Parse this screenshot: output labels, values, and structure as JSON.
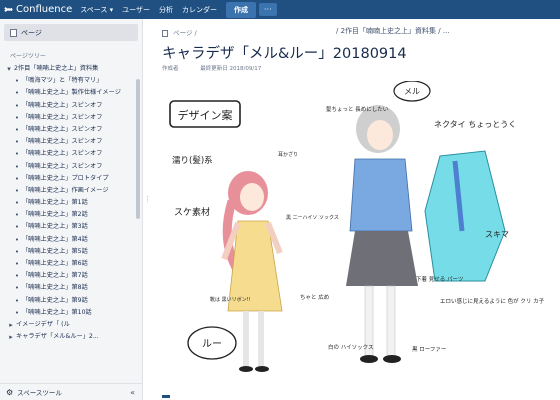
{
  "topbar": {
    "logo": "Confluence",
    "nav": [
      "スペース ▾",
      "ユーザー",
      "分析",
      "カレンダー"
    ],
    "create": "作成",
    "more": "···"
  },
  "sidebar": {
    "pages_label": "ページ",
    "tree_heading": "ページツリー",
    "items": [
      {
        "bullet": "▾",
        "label": "2作目「喃喃上史之上」資料集",
        "level": 0
      },
      {
        "bullet": "•",
        "label": "「鳴海マツ」と「特有マリ」",
        "level": 1
      },
      {
        "bullet": "•",
        "label": "「喃喃上史之上」製作仕様イメージ",
        "level": 1
      },
      {
        "bullet": "•",
        "label": "「喃喃上史之上」スピンオフ",
        "level": 1
      },
      {
        "bullet": "•",
        "label": "「喃喃上史之上」スピンオフ",
        "level": 1
      },
      {
        "bullet": "•",
        "label": "「喃喃上史之上」スピンオフ",
        "level": 1
      },
      {
        "bullet": "•",
        "label": "「喃喃上史之上」スピンオフ",
        "level": 1
      },
      {
        "bullet": "•",
        "label": "「喃喃上史之上」スピンオフ",
        "level": 1
      },
      {
        "bullet": "•",
        "label": "「喃喃上史之上」スピンオフ",
        "level": 1
      },
      {
        "bullet": "•",
        "label": "「喃喃上史之上」プロトタイプ",
        "level": 1
      },
      {
        "bullet": "•",
        "label": "「喃喃上史之上」作画イメージ",
        "level": 1
      },
      {
        "bullet": "•",
        "label": "「喃喃上史之上」第1話",
        "level": 1
      },
      {
        "bullet": "•",
        "label": "「喃喃上史之上」第2話",
        "level": 1
      },
      {
        "bullet": "•",
        "label": "「喃喃上史之上」第3話",
        "level": 1
      },
      {
        "bullet": "•",
        "label": "「喃喃上史之上」第4話",
        "level": 1
      },
      {
        "bullet": "•",
        "label": "「喃喃上史之上」第5話",
        "level": 1
      },
      {
        "bullet": "•",
        "label": "「喃喃上史之上」第6話",
        "level": 1
      },
      {
        "bullet": "•",
        "label": "「喃喃上史之上」第7話",
        "level": 1
      },
      {
        "bullet": "•",
        "label": "「喃喃上史之上」第8話",
        "level": 1
      },
      {
        "bullet": "•",
        "label": "「喃喃上史之上」第9話",
        "level": 1
      },
      {
        "bullet": "•",
        "label": "「喃喃上史之上」第10話",
        "level": 1
      },
      {
        "bullet": "▸",
        "label": "イメージデザ「                    (ル",
        "level": 2
      },
      {
        "bullet": "▸",
        "label": "キャラデザ「メル&ルー」2...",
        "level": 2
      }
    ],
    "footer": "スペースツール",
    "collapse": "«"
  },
  "page": {
    "breadcrumb": "ページ  /",
    "breadcrumb_trail": "/ 2作目「喃喃上史之上」資料集 / ...",
    "title": "キャラデザ「メル&ルー」20180914",
    "author": "作成者",
    "updated": "最終更新日 2018/09/17"
  },
  "artwork": {
    "heading_box": "デザイン案",
    "note_twintail": "濡り(髪)系",
    "note_hair": "耳かざり",
    "note_skirt": "スケ素材",
    "note_ribbon": "黒 二ーハイソ ソックス",
    "note_lace": "靴は 黒いリボン!!",
    "note_hime": "ちゃと 広め",
    "speech_left": "ルー",
    "speech_right": "メル",
    "note_hairpin": "髪ちょっと 長めにしたい",
    "note_necktie": "ネクタイ ちょっとうく",
    "note_pants": "下着 見せる パーツ",
    "note_sleeves": "スキマ",
    "note_shoes": "黒 ローファー",
    "note_socks": "白の ハイソックス",
    "note_bottom": "エロい感じに見えるように 色が クリ カ子",
    "colors": {
      "hair_pink": "#e8909a",
      "dress_yellow": "#f6dc8e",
      "jacket_blue": "#7aa8e0",
      "skirt_gray": "#6f6f78",
      "coat_cyan": "#76dde8",
      "hair_silver": "#cfcfcf"
    }
  }
}
